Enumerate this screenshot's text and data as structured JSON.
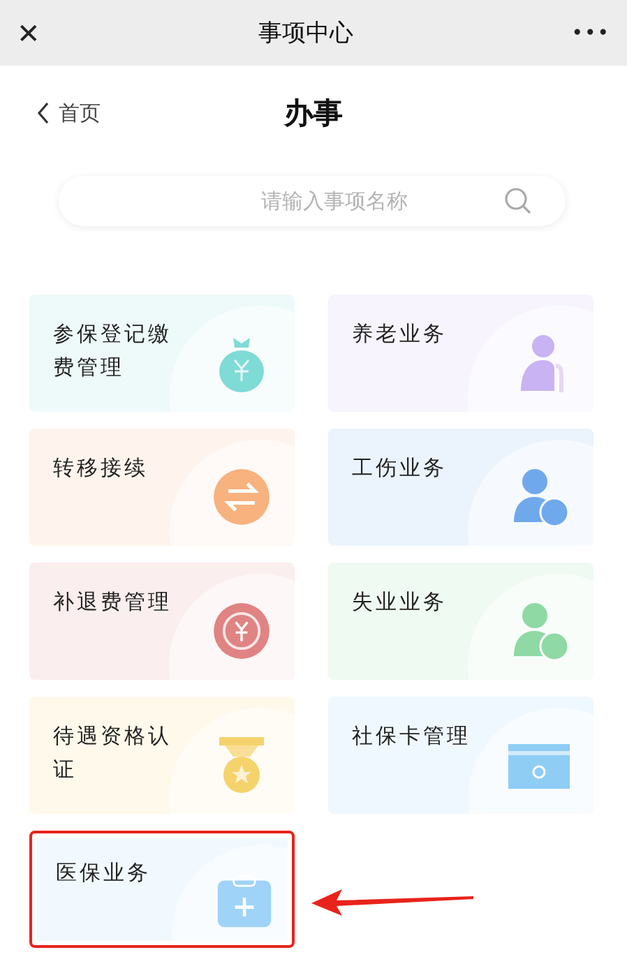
{
  "window": {
    "title": "事项中心",
    "close": "✕",
    "more": "•••"
  },
  "header": {
    "back": "首页",
    "title": "办事"
  },
  "search": {
    "placeholder": "请输入事项名称"
  },
  "cards": [
    {
      "label": "参保登记缴费管理",
      "kind": "moneybag",
      "color": "#7fdbd6",
      "highlighted": false
    },
    {
      "label": "养老业务",
      "kind": "elder",
      "color": "#c9b3f2",
      "highlighted": false
    },
    {
      "label": "转移接续",
      "kind": "exchange",
      "color": "#f7b27e",
      "highlighted": false
    },
    {
      "label": "工伤业务",
      "kind": "person",
      "color": "#6fa9ec",
      "highlighted": false
    },
    {
      "label": "补退费管理",
      "kind": "refund",
      "color": "#e08383",
      "highlighted": false
    },
    {
      "label": "失业业务",
      "kind": "person",
      "color": "#8fd9a4",
      "highlighted": false
    },
    {
      "label": "待遇资格认证",
      "kind": "medal",
      "color": "#f5d36c",
      "highlighted": false
    },
    {
      "label": "社保卡管理",
      "kind": "card",
      "color": "#8fcdf5",
      "highlighted": false
    },
    {
      "label": "医保业务",
      "kind": "medkit",
      "color": "#9fd3f7",
      "highlighted": true
    }
  ]
}
